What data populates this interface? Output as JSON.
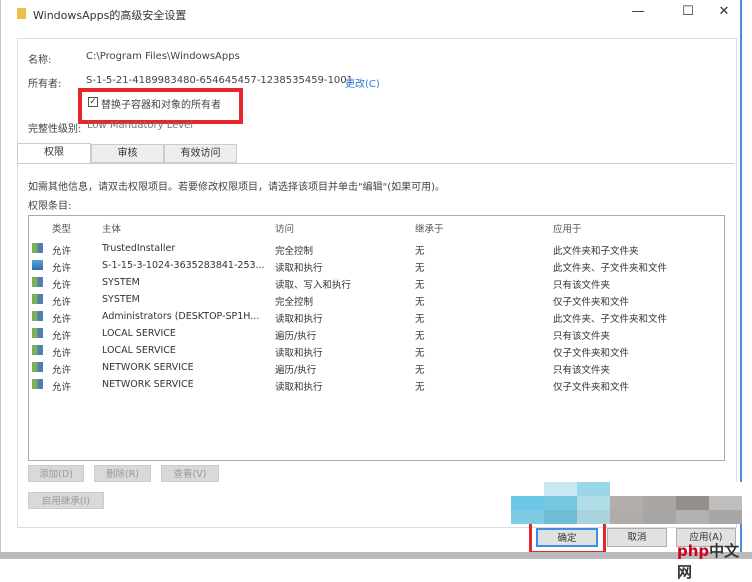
{
  "window": {
    "title": "WindowsApps的高级安全设置",
    "minimize": "—",
    "maximize": "☐",
    "close": "✕"
  },
  "info": {
    "name_label": "名称:",
    "name_value": "C:\\Program Files\\WindowsApps",
    "owner_label": "所有者:",
    "owner_value": "S-1-5-21-4189983480-654645457-1238535459-1001",
    "change_link": "更改(C)",
    "replace_checkbox": "替换子容器和对象的所有者",
    "replace_checked": true,
    "integrity_label": "完整性级别:",
    "integrity_value": "Low Mandatory Level"
  },
  "tabs": [
    "权限",
    "审核",
    "有效访问"
  ],
  "instructions": "如需其他信息，请双击权限项目。若要修改权限项目，请选择该项目并单击\"编辑\"(如果可用)。",
  "entries_label": "权限条目:",
  "table": {
    "headers": [
      "类型",
      "主体",
      "访问",
      "继承于",
      "应用于"
    ],
    "rows": [
      [
        "允许",
        "TrustedInstaller",
        "完全控制",
        "无",
        "此文件夹和子文件夹"
      ],
      [
        "允许",
        "S-1-15-3-1024-3635283841-253...",
        "读取和执行",
        "无",
        "此文件夹、子文件夹和文件"
      ],
      [
        "允许",
        "SYSTEM",
        "读取、写入和执行",
        "无",
        "只有该文件夹"
      ],
      [
        "允许",
        "SYSTEM",
        "完全控制",
        "无",
        "仅子文件夹和文件"
      ],
      [
        "允许",
        "Administrators (DESKTOP-SP1H...",
        "读取和执行",
        "无",
        "此文件夹、子文件夹和文件"
      ],
      [
        "允许",
        "LOCAL SERVICE",
        "遍历/执行",
        "无",
        "只有该文件夹"
      ],
      [
        "允许",
        "LOCAL SERVICE",
        "读取和执行",
        "无",
        "仅子文件夹和文件"
      ],
      [
        "允许",
        "NETWORK SERVICE",
        "遍历/执行",
        "无",
        "只有该文件夹"
      ],
      [
        "允许",
        "NETWORK SERVICE",
        "读取和执行",
        "无",
        "仅子文件夹和文件"
      ]
    ]
  },
  "buttons": {
    "add": "添加(D)",
    "remove": "删除(R)",
    "view": "查看(V)",
    "enable_inheritance": "启用继承(I)",
    "ok": "确定",
    "cancel": "取消",
    "apply": "应用(A)"
  },
  "watermark": "php中文网"
}
